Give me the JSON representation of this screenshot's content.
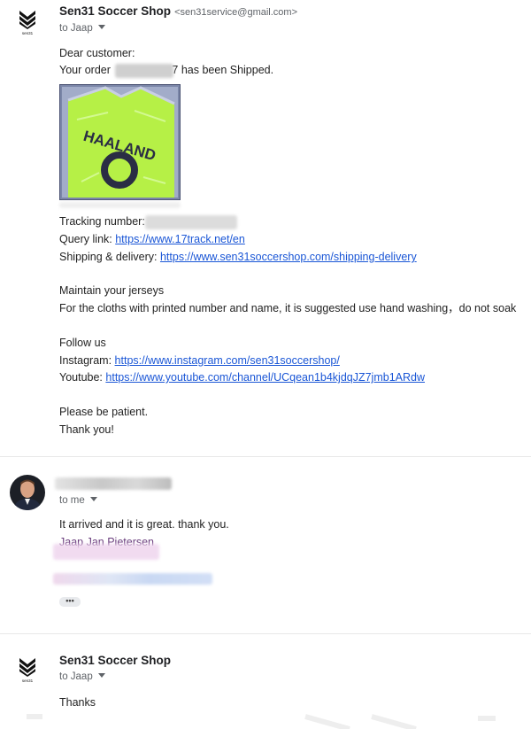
{
  "messages": [
    {
      "sender_name": "Sen31 Soccer Shop",
      "sender_email": "<sen31service@gmail.com>",
      "to": "to Jaap",
      "greeting": "Dear customer:",
      "order_prefix": "Your order",
      "order_suffix": "7 has been Shipped.",
      "tracking_label": "Tracking number:",
      "query_label": "Query link:",
      "query_url": "https://www.17track.net/en",
      "shipping_label": "Shipping & delivery:",
      "shipping_url": "https://www.sen31soccershop.com/shipping-delivery",
      "maintain_title": "Maintain your jerseys",
      "maintain_text": "For the cloths with printed number and name, it is suggested use hand washing，do not soak",
      "follow_title": "Follow us",
      "instagram_label": "Instagram:",
      "instagram_url": "https://www.instagram.com/sen31soccershop/",
      "youtube_label": "Youtube:",
      "youtube_url": "https://www.youtube.com/channel/UCqean1b4kjdqJZ7jmb1ARdw",
      "patience": "Please be patient.",
      "thanks": "Thank you!",
      "logo_text": "sen31"
    },
    {
      "to": "to me",
      "reply": "It arrived and it is great. thank you.",
      "signature_name": "Jaap Jan Pietersen"
    },
    {
      "sender_name": "Sen31 Soccer Shop",
      "to": "to Jaap",
      "body": "Thanks",
      "logo_text": "sen31"
    }
  ],
  "product_image_text": "HAALAND",
  "colors": {
    "link": "#1a56d6",
    "jersey": "#b6f046",
    "muted": "#5f6368"
  }
}
